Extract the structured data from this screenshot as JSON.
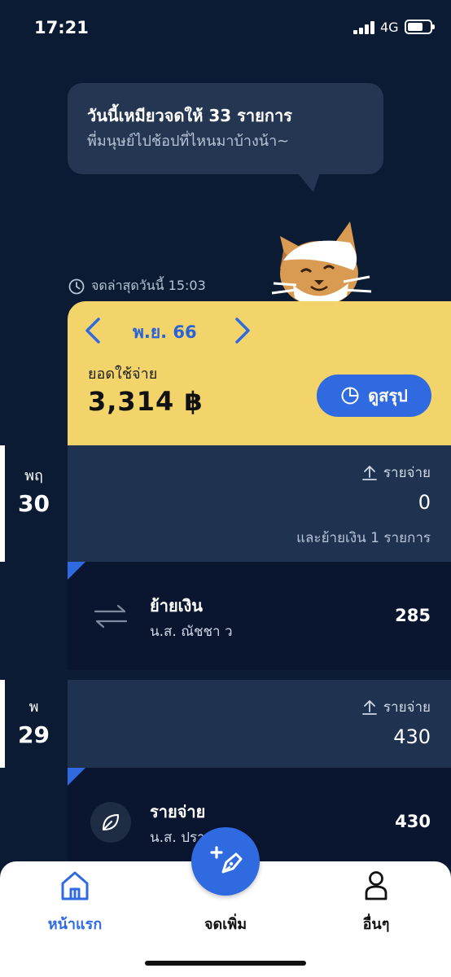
{
  "status_bar": {
    "time": "17:21",
    "network": "4G"
  },
  "mascot": {
    "message_line1": "วันนี้เหมียวจดให้ 33 รายการ",
    "message_line2": "พี่มนุษย์ไปช้อปที่ไหนมาบ้างน้า~"
  },
  "last_saved": "จดล่าสุดวันนี้ 15:03",
  "summary": {
    "month": "พ.ย. 66",
    "spend_label": "ยอดใช้จ่าย",
    "spend_value": "3,314 ฿",
    "summary_button": "ดูสรุป"
  },
  "days": [
    {
      "dow": "พฤ",
      "date": "30",
      "expense_label": "รายจ่าย",
      "total": "0",
      "note": "และย้ายเงิน 1 รายการ",
      "transaction": {
        "title": "ย้ายเงิน",
        "subtitle": "น.ส. ณัชชา ว",
        "amount": "285",
        "icon": "transfer-icon"
      }
    },
    {
      "dow": "พ",
      "date": "29",
      "expense_label": "รายจ่าย",
      "total": "430",
      "transaction": {
        "title": "รายจ่าย",
        "subtitle": "น.ส. ปรา    ษย์ ป",
        "amount": "430",
        "icon": "leaf-icon"
      }
    }
  ],
  "nav": {
    "home": "หน้าแรก",
    "add": "จดเพิ่ม",
    "more": "อื่นๆ"
  },
  "colors": {
    "background": "#0b1b33",
    "card_yellow": "#f2d46b",
    "accent_blue": "#2f6ae0"
  }
}
